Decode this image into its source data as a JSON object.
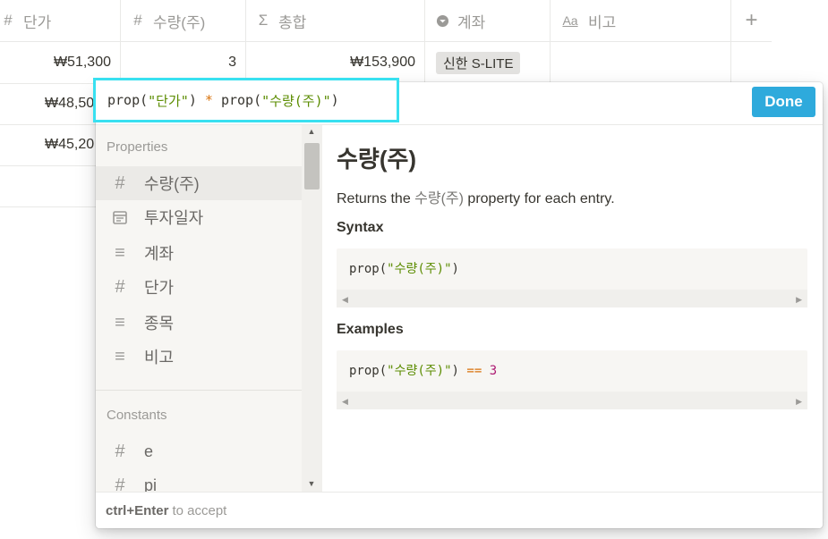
{
  "table": {
    "columns": [
      {
        "icon": "hash-icon",
        "glyph": "#",
        "label": "단가"
      },
      {
        "icon": "hash-icon",
        "glyph": "#",
        "label": "수량(주)"
      },
      {
        "icon": "sigma-icon",
        "glyph": "Σ",
        "label": "총합"
      },
      {
        "icon": "select-icon",
        "glyph": "▾",
        "label": "계좌"
      },
      {
        "icon": "text-icon",
        "glyph": "Aa",
        "label": "비고"
      }
    ],
    "add_column": "+",
    "rows": [
      {
        "price": "₩51,300",
        "qty": "3",
        "total": "₩153,900",
        "account": "신한 S-LITE"
      },
      {
        "price": "₩48,50"
      },
      {
        "price": "₩45,20"
      }
    ]
  },
  "formula": {
    "fn1": "prop(",
    "arg1": "\"단가\"",
    "close1": ")",
    "op": "*",
    "fn2": "prop(",
    "arg2": "\"수량(주)\"",
    "close2": ")"
  },
  "done_label": "Done",
  "properties": {
    "label": "Properties",
    "items": [
      {
        "icon": "hash-icon",
        "glyph": "#",
        "label": "수량(주)"
      },
      {
        "icon": "calendar-icon",
        "glyph": "▤",
        "label": "투자일자"
      },
      {
        "icon": "text-lines-icon",
        "glyph": "≡",
        "label": "계좌"
      },
      {
        "icon": "hash-icon",
        "glyph": "#",
        "label": "단가"
      },
      {
        "icon": "text-lines-icon",
        "glyph": "≡",
        "label": "종목"
      },
      {
        "icon": "text-lines-icon",
        "glyph": "≡",
        "label": "비고"
      }
    ]
  },
  "constants": {
    "label": "Constants",
    "items": [
      {
        "icon": "hash-icon",
        "glyph": "#",
        "label": "e"
      },
      {
        "icon": "hash-icon",
        "glyph": "#",
        "label": "pi"
      }
    ]
  },
  "detail": {
    "title": "수량(주)",
    "desc_prefix": "Returns the ",
    "desc_prop": "수량(주)",
    "desc_suffix": " property for each entry.",
    "syntax_label": "Syntax",
    "syntax_fn": "prop(",
    "syntax_arg": "\"수량(주)\"",
    "syntax_close": ")",
    "examples_label": "Examples",
    "example_fn": "prop(",
    "example_arg": "\"수량(주)\"",
    "example_close": ")",
    "example_op": "==",
    "example_val": "3"
  },
  "footer": {
    "shortcut": "ctrl+Enter",
    "text": "to accept"
  }
}
